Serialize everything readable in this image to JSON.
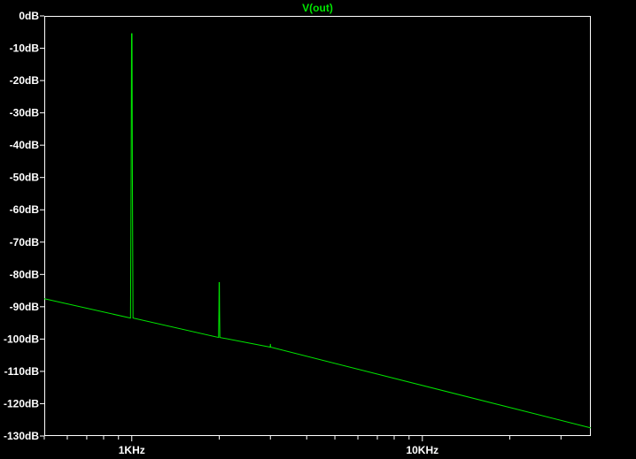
{
  "chart_data": {
    "type": "line",
    "title": "V(out)",
    "xlabel": "",
    "ylabel": "",
    "x_scale": "log",
    "xlim": [
      500,
      38000
    ],
    "ylim": [
      -130,
      0
    ],
    "grid": false,
    "legend": "none",
    "y_ticks": [
      {
        "value": 0,
        "label": "0dB"
      },
      {
        "value": -10,
        "label": "-10dB"
      },
      {
        "value": -20,
        "label": "-20dB"
      },
      {
        "value": -30,
        "label": "-30dB"
      },
      {
        "value": -40,
        "label": "-40dB"
      },
      {
        "value": -50,
        "label": "-50dB"
      },
      {
        "value": -60,
        "label": "-60dB"
      },
      {
        "value": -70,
        "label": "-70dB"
      },
      {
        "value": -80,
        "label": "-80dB"
      },
      {
        "value": -90,
        "label": "-90dB"
      },
      {
        "value": -100,
        "label": "-100dB"
      },
      {
        "value": -110,
        "label": "-110dB"
      },
      {
        "value": -120,
        "label": "-120dB"
      },
      {
        "value": -130,
        "label": "-130dB"
      }
    ],
    "x_ticks": [
      {
        "value": 1000,
        "label": "1KHz"
      },
      {
        "value": 10000,
        "label": "10KHz"
      }
    ],
    "series": [
      {
        "name": "V(out)",
        "color": "#00e600",
        "points": [
          {
            "x": 500,
            "y": -87.5
          },
          {
            "x": 990,
            "y": -93.5
          },
          {
            "x": 995,
            "y": -49.5
          },
          {
            "x": 998,
            "y": -5.5
          },
          {
            "x": 1002,
            "y": -5.5
          },
          {
            "x": 1005,
            "y": -49.5
          },
          {
            "x": 1010,
            "y": -93.5
          },
          {
            "x": 1990,
            "y": -99.5
          },
          {
            "x": 1995,
            "y": -91
          },
          {
            "x": 1998,
            "y": -82.5
          },
          {
            "x": 2002,
            "y": -82.5
          },
          {
            "x": 2005,
            "y": -91
          },
          {
            "x": 2010,
            "y": -99.5
          },
          {
            "x": 2995,
            "y": -102.5
          },
          {
            "x": 3000,
            "y": -101.5
          },
          {
            "x": 3005,
            "y": -102.5
          },
          {
            "x": 38000,
            "y": -127.5
          }
        ]
      }
    ]
  }
}
